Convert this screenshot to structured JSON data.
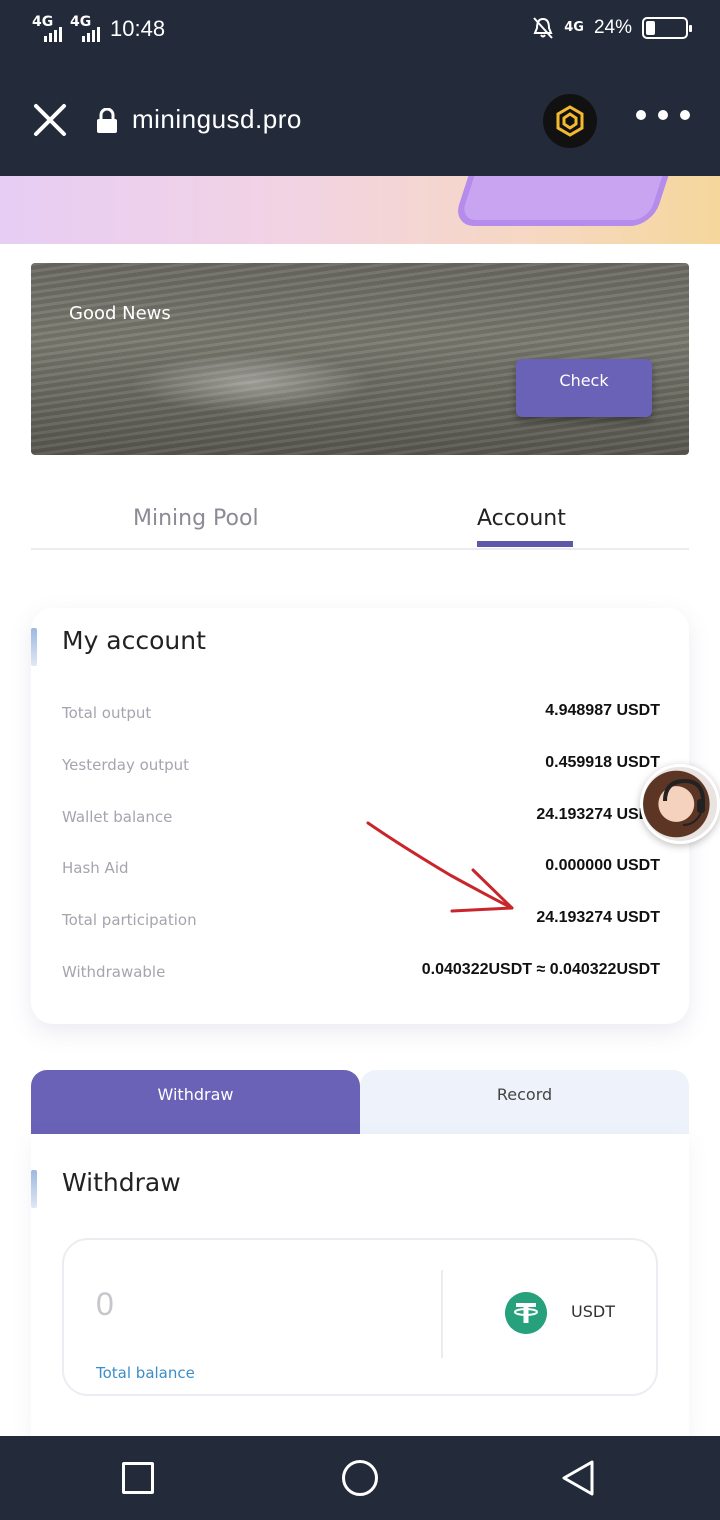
{
  "status_bar": {
    "signal_1": "4G",
    "signal_2": "4G",
    "time": "10:48",
    "network": "4G",
    "battery_percent": "24%",
    "battery_level": 0.24
  },
  "browser": {
    "url": "miningusd.pro",
    "close_icon": "close-icon",
    "lock_icon": "lock-icon",
    "app_icon": "binance-icon",
    "menu_icon": "more-horizontal-icon"
  },
  "banner": {
    "title": "Good News",
    "button_label": "Check"
  },
  "tabs": {
    "items": [
      {
        "label": "Mining Pool",
        "active": false
      },
      {
        "label": "Account",
        "active": true
      }
    ],
    "accent": "#5e58a8"
  },
  "account": {
    "title": "My account",
    "rows": [
      {
        "label": "Total output",
        "value": "4.948987 USDT"
      },
      {
        "label": "Yesterday output",
        "value": "0.459918 USDT"
      },
      {
        "label": "Wallet balance",
        "value": "24.193274 USDT"
      },
      {
        "label": "Hash Aid",
        "value": "0.000000 USDT"
      },
      {
        "label": "Total participation",
        "value": "24.193274 USDT"
      },
      {
        "label": "Withdrawable",
        "value": "0.040322USDT ≈ 0.040322USDT"
      }
    ]
  },
  "segments": {
    "withdraw_label": "Withdraw",
    "record_label": "Record",
    "active_color": "#6a62b6"
  },
  "withdraw": {
    "title": "Withdraw",
    "amount_placeholder": "0",
    "balance_label": "Total balance",
    "currency": "USDT",
    "currency_icon": "tether-icon"
  },
  "nav": {
    "recent_icon": "recent-apps-icon",
    "home_icon": "home-icon",
    "back_icon": "back-icon"
  }
}
